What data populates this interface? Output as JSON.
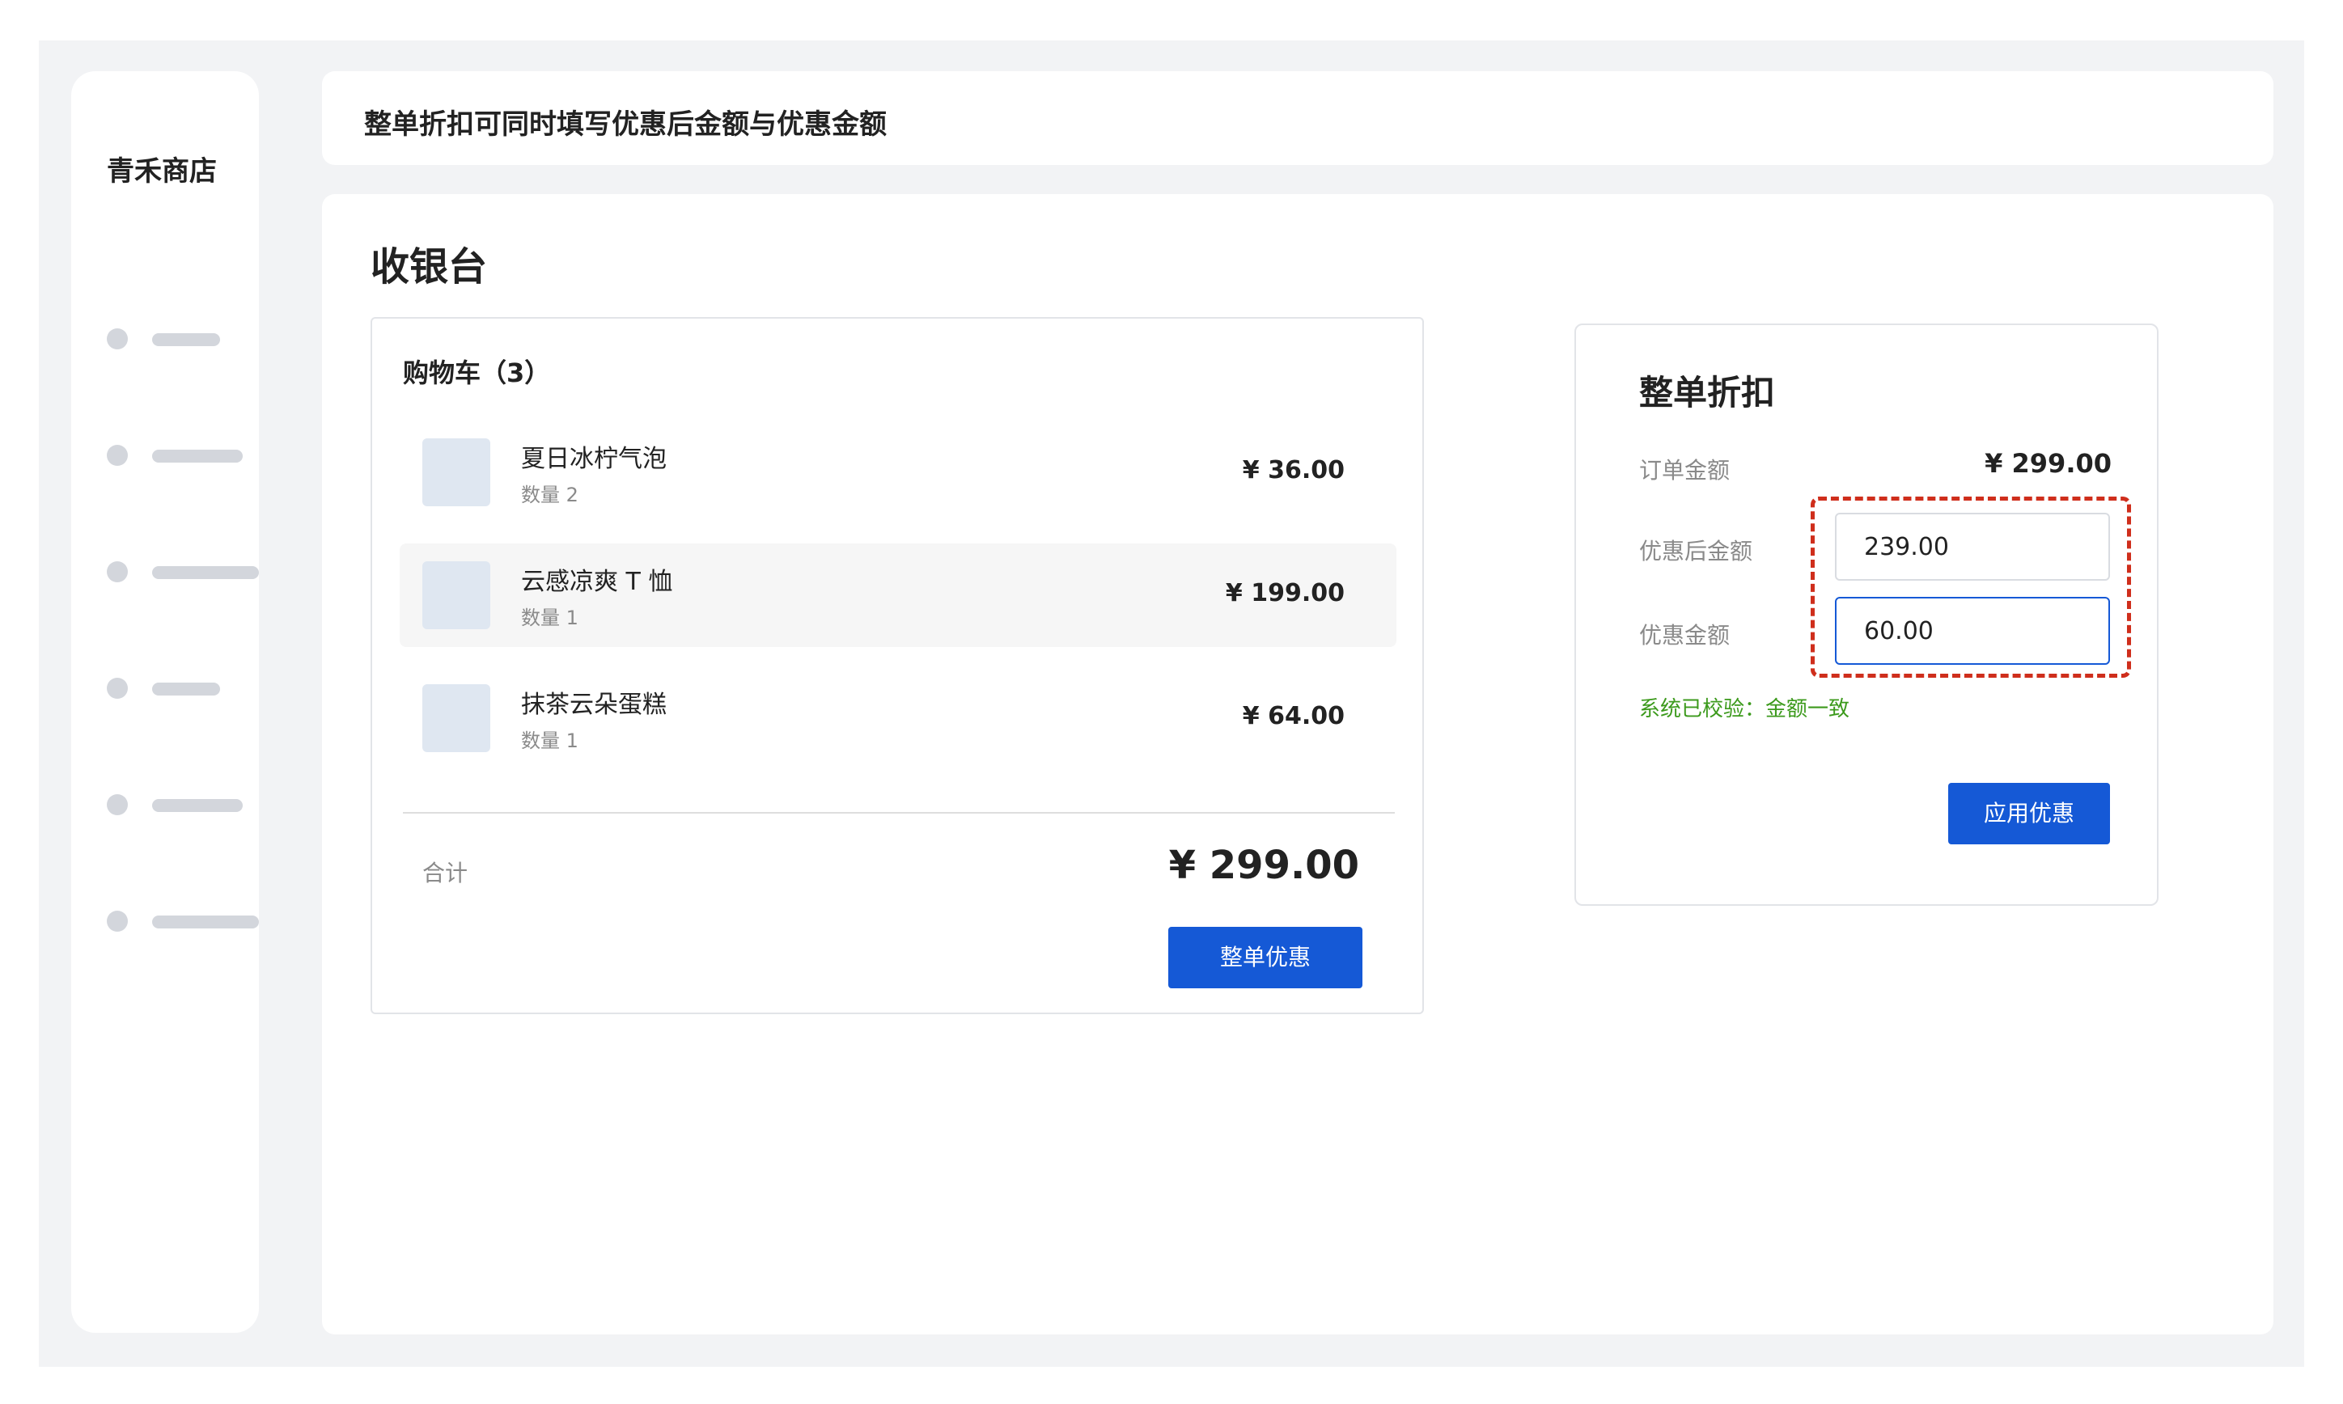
{
  "sidebar": {
    "brand": "青禾商店",
    "items": [
      {
        "icon": "nav-dot"
      },
      {
        "icon": "nav-dot"
      },
      {
        "icon": "nav-dot"
      },
      {
        "icon": "nav-dot"
      },
      {
        "icon": "nav-dot"
      },
      {
        "icon": "nav-dot"
      }
    ]
  },
  "header": {
    "title": "整单折扣可同时填写优惠后金额与优惠金额"
  },
  "main": {
    "page_title": "收银台",
    "cart": {
      "title": "购物车（3）",
      "items": [
        {
          "name": "夏日冰柠气泡",
          "qty": "数量 2",
          "price": "¥ 36.00"
        },
        {
          "name": "云感凉爽 T 恤",
          "qty": "数量 1",
          "price": "¥ 199.00"
        },
        {
          "name": "抹茶云朵蛋糕",
          "qty": "数量 1",
          "price": "¥ 64.00"
        }
      ],
      "total_label": "合计",
      "total_value": "¥ 299.00",
      "whole_discount_button": "整单优惠"
    },
    "discount_panel": {
      "title": "整单折扣",
      "order_amount_label": "订单金额",
      "order_amount_value": "¥ 299.00",
      "after_discount_label": "优惠后金额",
      "after_discount_value": "239.00",
      "discount_amount_label": "优惠金额",
      "discount_amount_value": "60.00",
      "validation_text": "系统已校验：金额一致",
      "apply_button": "应用优惠"
    }
  },
  "colors": {
    "accent": "#1559d6",
    "highlight_border": "#cf2e1c",
    "success": "#3c9a1c",
    "background": "#f2f3f5"
  }
}
